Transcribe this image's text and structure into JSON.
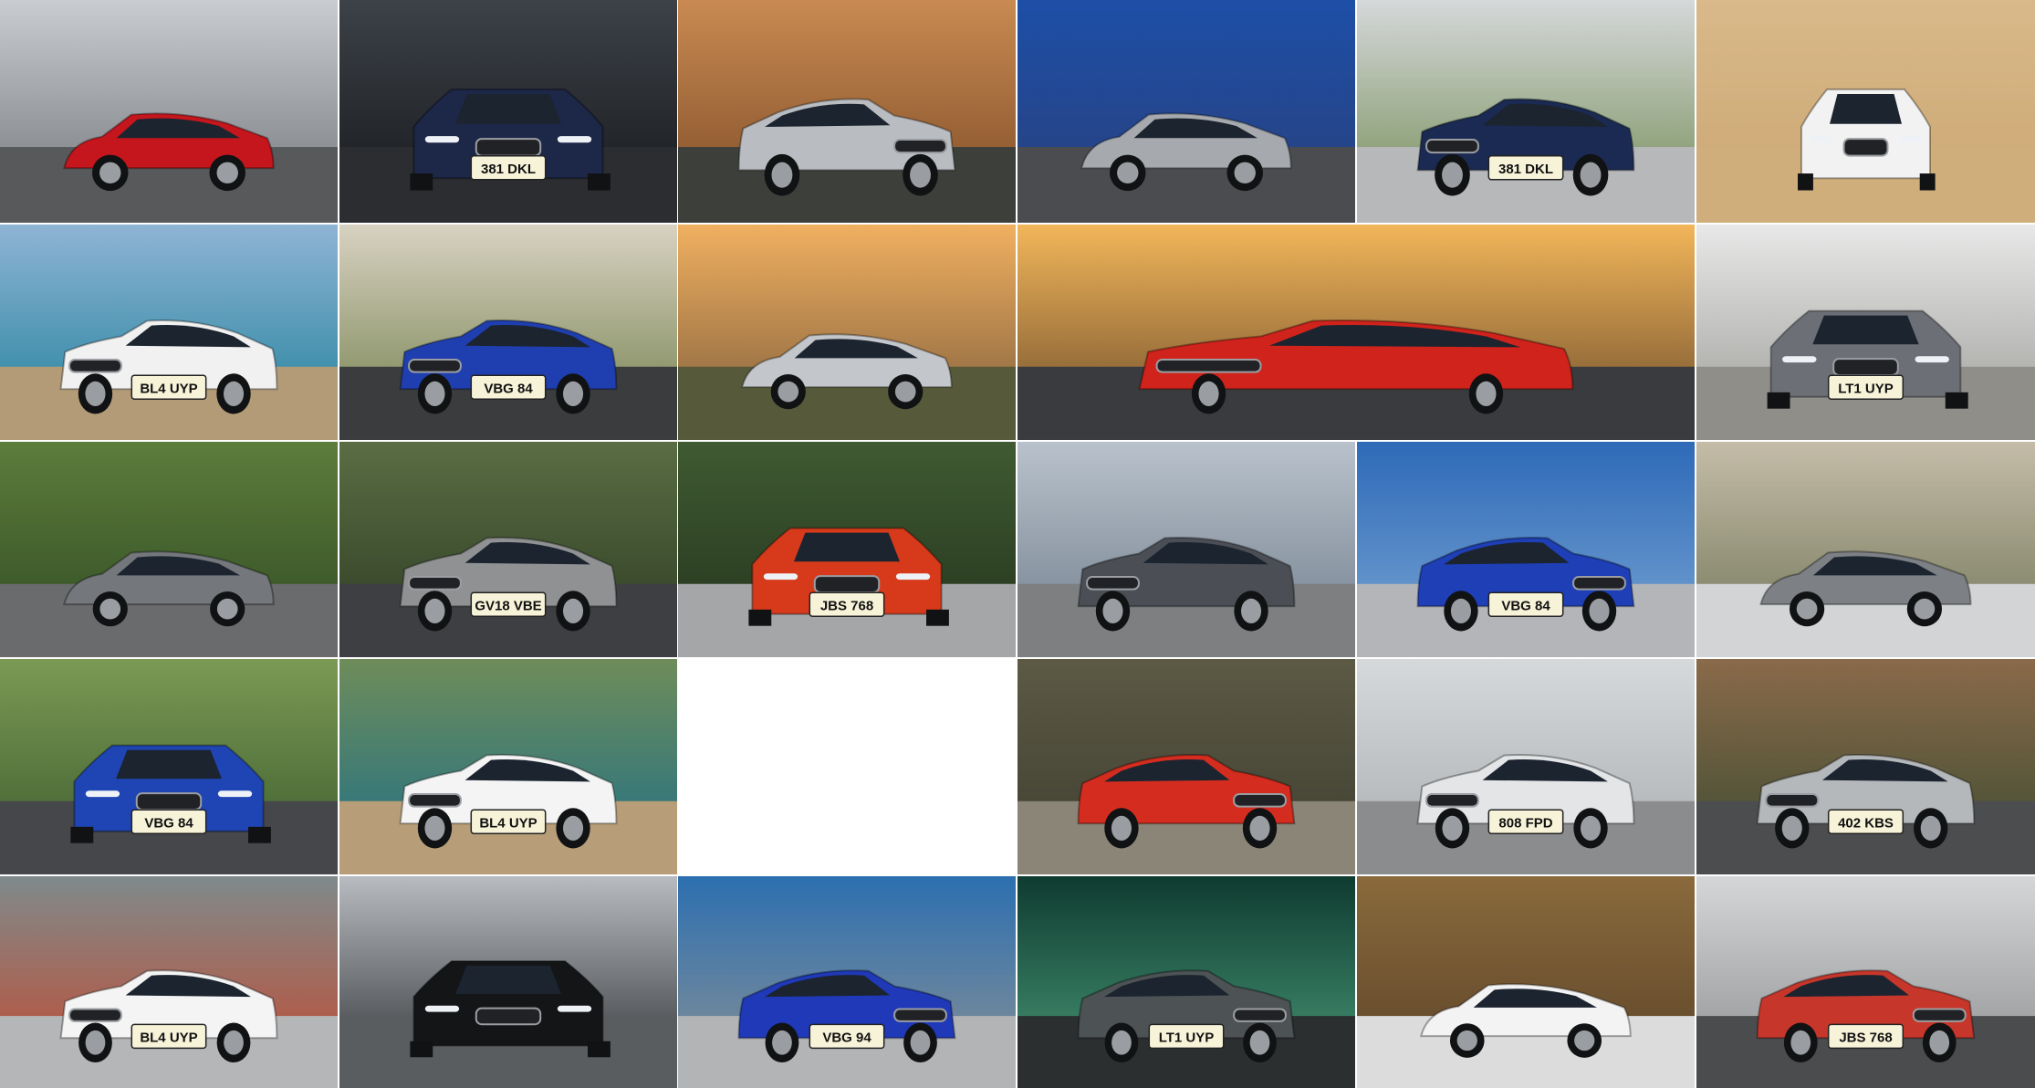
{
  "collage": {
    "columns": 6,
    "rows": 5,
    "tiles": [
      {
        "id": "t1",
        "bg": [
          "#c9ccd0",
          "#6f7378"
        ],
        "ground": "#58595b",
        "car": "#c4161c",
        "view": "side",
        "plate": ""
      },
      {
        "id": "t2",
        "bg": [
          "#3d4248",
          "#141619"
        ],
        "ground": "#2b2d30",
        "car": "#1d2748",
        "view": "front",
        "plate": "381 DKL"
      },
      {
        "id": "t3",
        "bg": [
          "#c98a52",
          "#7b4a25"
        ],
        "ground": "#3c3f3a",
        "car": "#b9bcc0",
        "view": "rear34",
        "plate": ""
      },
      {
        "id": "t4",
        "bg": [
          "#1d4fa7",
          "#2a3f7a"
        ],
        "ground": "#4a4c4f",
        "car": "#a6a9ad",
        "view": "side",
        "plate": ""
      },
      {
        "id": "t5",
        "bg": [
          "#d6d8da",
          "#6e8a50"
        ],
        "ground": "#b6b8ba",
        "car": "#1b2a52",
        "view": "front34",
        "plate": "381 DKL"
      },
      {
        "id": "t6",
        "bg": [
          "#d9b98a",
          "#caa571"
        ],
        "ground": "#cfae7c",
        "car": "#f2f2f2",
        "view": "top",
        "plate": ""
      },
      {
        "id": "t7",
        "bg": [
          "#8fb4d4",
          "#1b7f9a"
        ],
        "ground": "#b39b77",
        "car": "#f1f1f1",
        "view": "front34",
        "plate": "BL4 UYP"
      },
      {
        "id": "t8",
        "bg": [
          "#d8d2c2",
          "#6f7d48"
        ],
        "ground": "#3b3c3e",
        "car": "#1f3fb0",
        "view": "front34",
        "plate": "VBG 84"
      },
      {
        "id": "t9",
        "bg": [
          "#f0b060",
          "#7a5a3a"
        ],
        "ground": "#565a3a",
        "car": "#c3c6ca",
        "view": "side",
        "plate": ""
      },
      {
        "id": "t10",
        "bg": [
          "#f2b65a",
          "#6a4a2a"
        ],
        "ground": "#3a3b3e",
        "car": "#d0231c",
        "view": "front34",
        "plate": ""
      },
      {
        "id": "t11",
        "bg": [
          "#e8e8e8",
          "#9a9a96"
        ],
        "ground": "#8f8e88",
        "car": "#6c7076",
        "view": "front",
        "plate": "LT1 UYP"
      },
      {
        "id": "t12",
        "bg": [
          "#5c7d3c",
          "#2f4a22"
        ],
        "ground": "#6a6b6d",
        "car": "#74777c",
        "view": "side",
        "plate": ""
      },
      {
        "id": "t13",
        "bg": [
          "#5a6d44",
          "#2c3b22"
        ],
        "ground": "#3e3f42",
        "car": "#8f9193",
        "view": "front34",
        "plate": "GV18 VBE"
      },
      {
        "id": "t14",
        "bg": [
          "#3f5a32",
          "#24331c"
        ],
        "ground": "#a5a6a8",
        "car": "#d7391b",
        "view": "front",
        "plate": "JBS 768"
      },
      {
        "id": "t15",
        "bg": [
          "#b9c2cc",
          "#6e7c8a"
        ],
        "ground": "#7d7f81",
        "car": "#4b4f55",
        "view": "front34",
        "plate": ""
      },
      {
        "id": "t16",
        "bg": [
          "#2e6ab8",
          "#7aa6d4"
        ],
        "ground": "#b3b5b8",
        "car": "#1e3fb5",
        "view": "rear34",
        "plate": "VBG 84"
      },
      {
        "id": "t17",
        "bg": [
          "#c5bca8",
          "#6e7456"
        ],
        "ground": "#d3d4d6",
        "car": "#7d8085",
        "view": "side",
        "plate": ""
      },
      {
        "id": "t18",
        "bg": [
          "#7a9a54",
          "#3b5a2e"
        ],
        "ground": "#45474a",
        "car": "#1f45b4",
        "view": "front",
        "plate": "VBG 84"
      },
      {
        "id": "t19",
        "bg": [
          "#6e8c5a",
          "#1d6f88"
        ],
        "ground": "#b79e78",
        "car": "#f4f4f4",
        "view": "front34",
        "plate": "BL4 UYP",
        "span": 2
      },
      {
        "id": "t20",
        "bg": [
          "#5c5a44",
          "#3f3d30"
        ],
        "ground": "#8b8577",
        "car": "#d42d1f",
        "view": "rear34",
        "plate": ""
      },
      {
        "id": "t21",
        "bg": [
          "#d6d9db",
          "#a9acae"
        ],
        "ground": "#8a8c8e",
        "car": "#e3e5e7",
        "view": "front34",
        "plate": "808 FPD"
      },
      {
        "id": "t22",
        "bg": [
          "#8a6a4a",
          "#3a4a30"
        ],
        "ground": "#4b4d4f",
        "car": "#b5b8bb",
        "view": "front34",
        "plate": "402 KBS"
      },
      {
        "id": "t23",
        "bg": [
          "#7f8a8c",
          "#c5482c"
        ],
        "ground": "#b5b6b8",
        "car": "#f4f4f4",
        "view": "front34",
        "plate": "BL4 UYP"
      },
      {
        "id": "t24",
        "bg": [
          "#b8bcc0",
          "#2a2d30"
        ],
        "ground": "#5a5d60",
        "car": "#141517",
        "view": "front",
        "plate": ""
      },
      {
        "id": "t25",
        "bg": [
          "#2c6fb0",
          "#8d9294"
        ],
        "ground": "#b3b4b6",
        "car": "#1f39b8",
        "view": "rear34",
        "plate": "VBG 94"
      },
      {
        "id": "t26",
        "bg": [
          "#0f3b30",
          "#4a9c7a"
        ],
        "ground": "#2c2f30",
        "car": "#4d5254",
        "view": "rear34",
        "plate": "LT1 UYP"
      },
      {
        "id": "t27",
        "bg": [
          "#8a6a3c",
          "#5a4228"
        ],
        "ground": "#dcdcdc",
        "car": "#f3f3f3",
        "view": "side",
        "plate": ""
      },
      {
        "id": "t28",
        "bg": [
          "#d4d6d8",
          "#8a8c8e"
        ],
        "ground": "#4a4c4e",
        "car": "#c7362a",
        "view": "rear34",
        "plate": "JBS 768"
      }
    ]
  }
}
